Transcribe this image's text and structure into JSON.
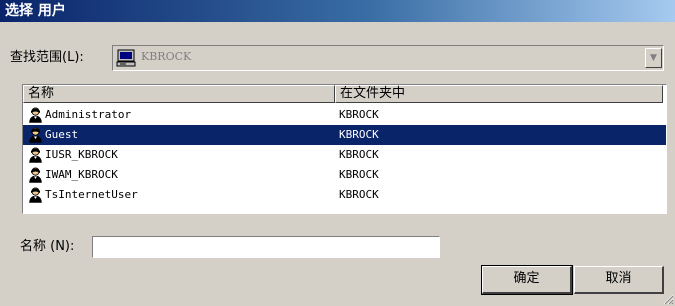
{
  "window": {
    "title": "选择 用户"
  },
  "lookin": {
    "label_prefix": "查找范围",
    "label_key": "(L):",
    "value": "KBROCK",
    "icon": "computer-icon"
  },
  "list": {
    "columns": [
      "名称",
      "在文件夹中"
    ],
    "rows": [
      {
        "name": "Administrator",
        "folder": "KBROCK",
        "icon": "user-icon"
      },
      {
        "name": "Guest",
        "folder": "KBROCK",
        "icon": "user-icon",
        "selected": true
      },
      {
        "name": "IUSR_KBROCK",
        "folder": "KBROCK",
        "icon": "user-icon"
      },
      {
        "name": "IWAM_KBROCK",
        "folder": "KBROCK",
        "icon": "user-icon"
      },
      {
        "name": "TsInternetUser",
        "folder": "KBROCK",
        "icon": "user-icon"
      }
    ],
    "selected_color": "#0a246a"
  },
  "name_field": {
    "label": "名称 (N):",
    "value": ""
  },
  "buttons": {
    "ok": "确定",
    "cancel": "取消"
  }
}
